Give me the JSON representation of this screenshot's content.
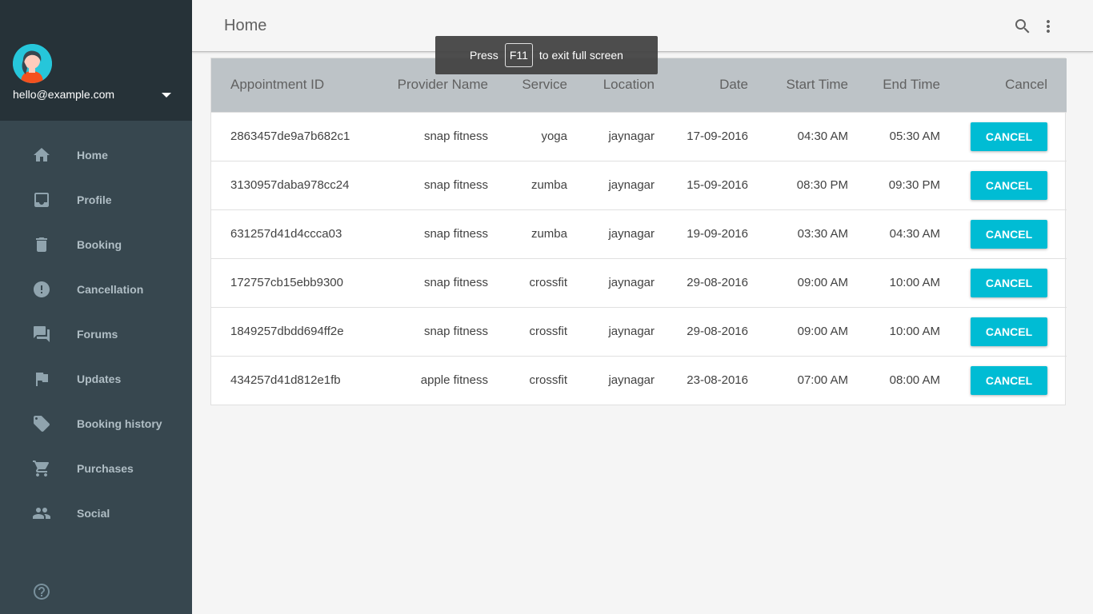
{
  "account": {
    "email": "hello@example.com"
  },
  "nav": {
    "items": [
      {
        "label": "Home",
        "icon": "home-icon"
      },
      {
        "label": "Profile",
        "icon": "inbox-icon"
      },
      {
        "label": "Booking",
        "icon": "trash-icon"
      },
      {
        "label": "Cancellation",
        "icon": "alert-icon"
      },
      {
        "label": "Forums",
        "icon": "forum-icon"
      },
      {
        "label": "Updates",
        "icon": "flag-icon"
      },
      {
        "label": "Booking history",
        "icon": "tag-icon"
      },
      {
        "label": "Purchases",
        "icon": "cart-icon"
      },
      {
        "label": "Social",
        "icon": "people-icon"
      }
    ]
  },
  "header": {
    "title": "Home"
  },
  "toast": {
    "before": "Press",
    "key": "F11",
    "after": "to exit full screen"
  },
  "table": {
    "columns": [
      "Appointment ID",
      "Provider Name",
      "Service",
      "Location",
      "Date",
      "Start Time",
      "End Time",
      "Cancel"
    ],
    "rows": [
      {
        "id": "2863457de9a7b682c1",
        "provider": "snap fitness",
        "service": "yoga",
        "location": "jaynagar",
        "date": "17-09-2016",
        "start": "04:30 AM",
        "end": "05:30 AM",
        "action": "CANCEL"
      },
      {
        "id": "3130957daba978cc24",
        "provider": "snap fitness",
        "service": "zumba",
        "location": "jaynagar",
        "date": "15-09-2016",
        "start": "08:30 PM",
        "end": "09:30 PM",
        "action": "CANCEL"
      },
      {
        "id": "631257d41d4ccca03",
        "provider": "snap fitness",
        "service": "zumba",
        "location": "jaynagar",
        "date": "19-09-2016",
        "start": "03:30 AM",
        "end": "04:30 AM",
        "action": "CANCEL"
      },
      {
        "id": "172757cb15ebb9300",
        "provider": "snap fitness",
        "service": "crossfit",
        "location": "jaynagar",
        "date": "29-08-2016",
        "start": "09:00 AM",
        "end": "10:00 AM",
        "action": "CANCEL"
      },
      {
        "id": "1849257dbdd694ff2e",
        "provider": "snap fitness",
        "service": "crossfit",
        "location": "jaynagar",
        "date": "29-08-2016",
        "start": "09:00 AM",
        "end": "10:00 AM",
        "action": "CANCEL"
      },
      {
        "id": "434257d41d812e1fb",
        "provider": "apple fitness",
        "service": "crossfit",
        "location": "jaynagar",
        "date": "23-08-2016",
        "start": "07:00 AM",
        "end": "08:00 AM",
        "action": "CANCEL"
      }
    ]
  },
  "colors": {
    "sidebar": "#37474f",
    "sidebar_header": "#263238",
    "accent": "#00bcd4",
    "table_header": "#bdc3c7"
  }
}
